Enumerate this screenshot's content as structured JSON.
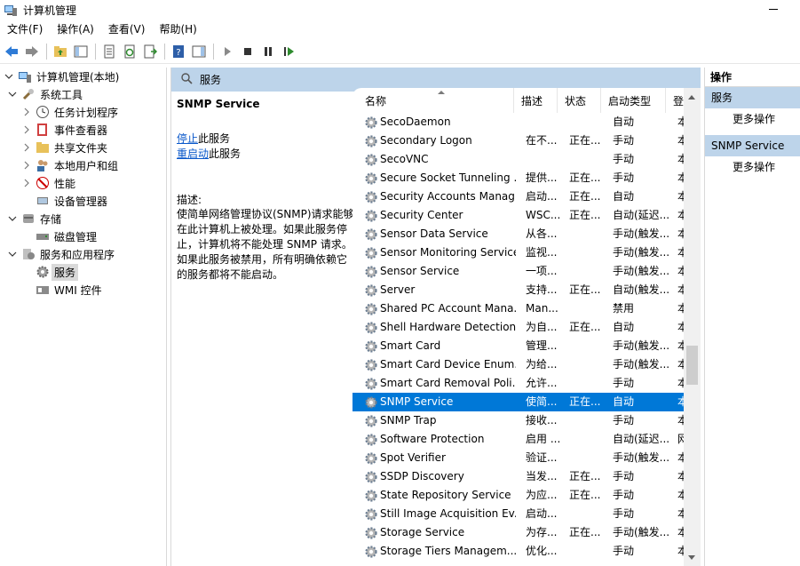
{
  "window": {
    "title": "计算机管理"
  },
  "menu": [
    "文件(F)",
    "操作(A)",
    "查看(V)",
    "帮助(H)"
  ],
  "tree": [
    {
      "label": "计算机管理(本地)",
      "level": 0,
      "expanded": true,
      "icon": "computer-management-icon"
    },
    {
      "label": "系统工具",
      "level": 1,
      "expanded": true,
      "icon": "tools-icon"
    },
    {
      "label": "任务计划程序",
      "level": 2,
      "expanded": false,
      "icon": "clock-icon"
    },
    {
      "label": "事件查看器",
      "level": 2,
      "expanded": false,
      "icon": "event-viewer-icon"
    },
    {
      "label": "共享文件夹",
      "level": 2,
      "expanded": false,
      "icon": "shared-folder-icon"
    },
    {
      "label": "本地用户和组",
      "level": 2,
      "expanded": false,
      "icon": "users-icon"
    },
    {
      "label": "性能",
      "level": 2,
      "expanded": false,
      "icon": "performance-icon"
    },
    {
      "label": "设备管理器",
      "level": 2,
      "expanded": null,
      "icon": "device-manager-icon"
    },
    {
      "label": "存储",
      "level": 1,
      "expanded": true,
      "icon": "storage-icon"
    },
    {
      "label": "磁盘管理",
      "level": 2,
      "expanded": null,
      "icon": "disk-icon"
    },
    {
      "label": "服务和应用程序",
      "level": 1,
      "expanded": true,
      "icon": "services-apps-icon"
    },
    {
      "label": "服务",
      "level": 2,
      "expanded": null,
      "icon": "services-icon",
      "selected": true
    },
    {
      "label": "WMI 控件",
      "level": 2,
      "expanded": null,
      "icon": "wmi-icon"
    }
  ],
  "center": {
    "header": "服务",
    "service_title": "SNMP Service",
    "stop_link": "停止",
    "stop_suffix": "此服务",
    "restart_link": "重启动",
    "restart_suffix": "此服务",
    "desc_label": "描述:",
    "description": "使简单网络管理协议(SNMP)请求能够在此计算机上被处理。如果此服务停止，计算机将不能处理 SNMP 请求。如果此服务被禁用，所有明确依赖它的服务都将不能启动。"
  },
  "columns": {
    "name": "名称",
    "desc": "描述",
    "status": "状态",
    "startup": "启动类型",
    "logon": "登"
  },
  "services": [
    {
      "name": "SecoDaemon",
      "desc": "",
      "status": "",
      "startup": "自动",
      "logon": "本"
    },
    {
      "name": "Secondary Logon",
      "desc": "在不...",
      "status": "正在...",
      "startup": "手动",
      "logon": "本"
    },
    {
      "name": "SecoVNC",
      "desc": "",
      "status": "",
      "startup": "手动",
      "logon": "本"
    },
    {
      "name": "Secure Socket Tunneling ...",
      "desc": "提供...",
      "status": "正在...",
      "startup": "手动",
      "logon": "本"
    },
    {
      "name": "Security Accounts Manag...",
      "desc": "启动...",
      "status": "正在...",
      "startup": "自动",
      "logon": "本"
    },
    {
      "name": "Security Center",
      "desc": "WSC...",
      "status": "正在...",
      "startup": "自动(延迟...",
      "logon": "本"
    },
    {
      "name": "Sensor Data Service",
      "desc": "从各...",
      "status": "",
      "startup": "手动(触发...",
      "logon": "本"
    },
    {
      "name": "Sensor Monitoring Service",
      "desc": "监视...",
      "status": "",
      "startup": "手动(触发...",
      "logon": "本"
    },
    {
      "name": "Sensor Service",
      "desc": "一项...",
      "status": "",
      "startup": "手动(触发...",
      "logon": "本"
    },
    {
      "name": "Server",
      "desc": "支持...",
      "status": "正在...",
      "startup": "自动(触发...",
      "logon": "本"
    },
    {
      "name": "Shared PC Account Mana...",
      "desc": "Man...",
      "status": "",
      "startup": "禁用",
      "logon": "本"
    },
    {
      "name": "Shell Hardware Detection",
      "desc": "为自...",
      "status": "正在...",
      "startup": "自动",
      "logon": "本"
    },
    {
      "name": "Smart Card",
      "desc": "管理...",
      "status": "",
      "startup": "手动(触发...",
      "logon": "本"
    },
    {
      "name": "Smart Card Device Enum...",
      "desc": "为给...",
      "status": "",
      "startup": "手动(触发...",
      "logon": "本"
    },
    {
      "name": "Smart Card Removal Poli...",
      "desc": "允许...",
      "status": "",
      "startup": "手动",
      "logon": "本"
    },
    {
      "name": "SNMP Service",
      "desc": "使简...",
      "status": "正在...",
      "startup": "自动",
      "logon": "本",
      "selected": true
    },
    {
      "name": "SNMP Trap",
      "desc": "接收...",
      "status": "",
      "startup": "手动",
      "logon": "本"
    },
    {
      "name": "Software Protection",
      "desc": "启用 ...",
      "status": "",
      "startup": "自动(延迟...",
      "logon": "网"
    },
    {
      "name": "Spot Verifier",
      "desc": "验证...",
      "status": "",
      "startup": "手动(触发...",
      "logon": "本"
    },
    {
      "name": "SSDP Discovery",
      "desc": "当发...",
      "status": "正在...",
      "startup": "手动",
      "logon": "本"
    },
    {
      "name": "State Repository Service",
      "desc": "为应...",
      "status": "正在...",
      "startup": "手动",
      "logon": "本"
    },
    {
      "name": "Still Image Acquisition Ev...",
      "desc": "启动...",
      "status": "",
      "startup": "手动",
      "logon": "本"
    },
    {
      "name": "Storage Service",
      "desc": "为存...",
      "status": "正在...",
      "startup": "手动(触发...",
      "logon": "本"
    },
    {
      "name": "Storage Tiers Managem...",
      "desc": "优化...",
      "status": "",
      "startup": "手动",
      "logon": "本"
    }
  ],
  "actions": {
    "header": "操作",
    "group1": "服务",
    "group1_more": "更多操作",
    "group2": "SNMP Service",
    "group2_more": "更多操作"
  },
  "colors": {
    "selection": "#0078d7",
    "header_bg": "#bdd4ea",
    "link": "#0a58ca"
  }
}
